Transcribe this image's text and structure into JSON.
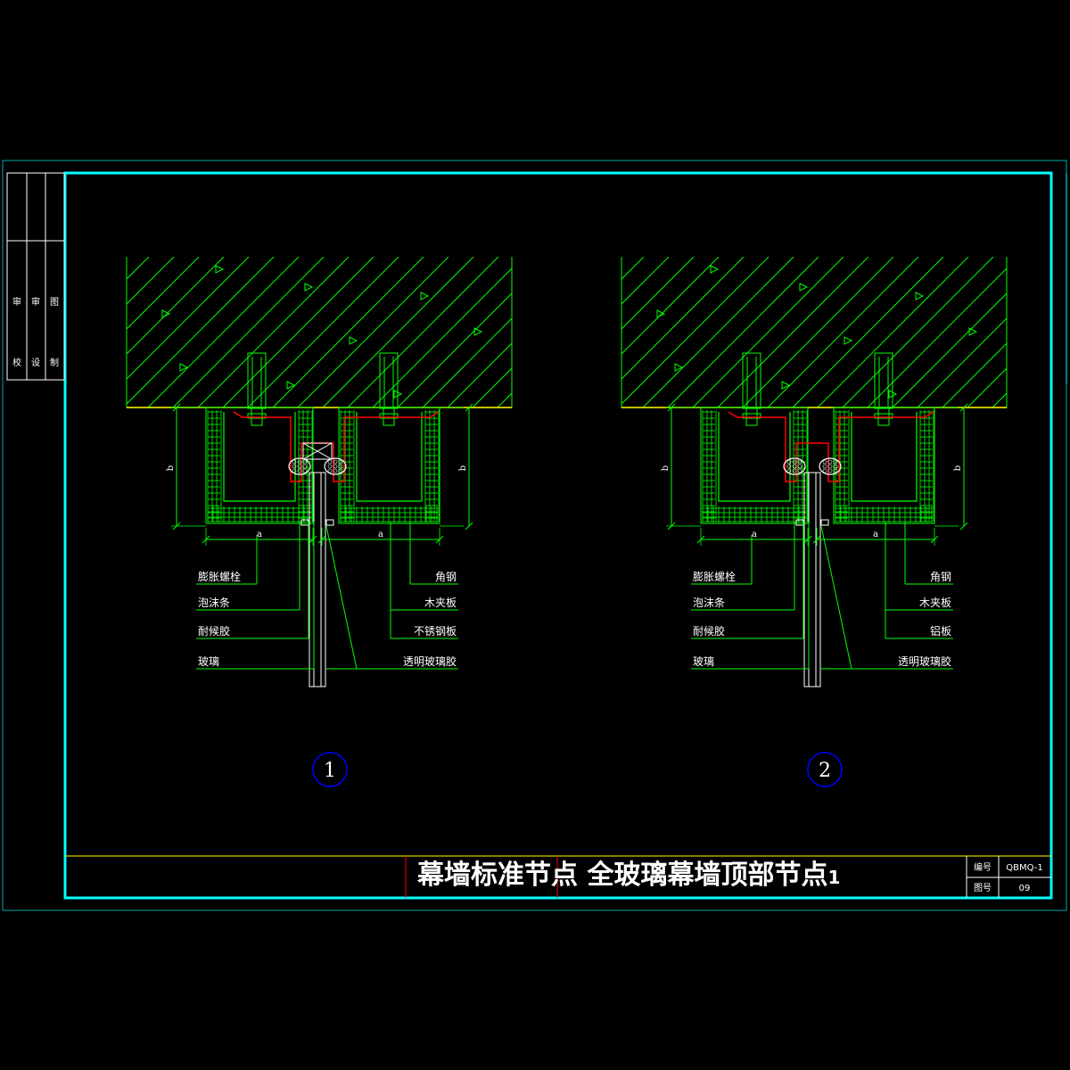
{
  "title": {
    "main": "幕墙标准节点 全玻璃幕墙顶部节点",
    "suffix": "1"
  },
  "title_block": {
    "code_label": "编号",
    "code_value": "QBMQ-1",
    "sheet_label": "图号",
    "sheet_value": "09"
  },
  "sign_column": {
    "top": [
      "审",
      "审",
      "图"
    ],
    "bottom": [
      "校",
      "设",
      "制"
    ]
  },
  "details": [
    {
      "number": "1",
      "dim_vertical": "b",
      "dim_horizontal": "a",
      "labels_left": [
        "膨胀螺栓",
        "泡沫条",
        "耐候胶",
        "玻璃"
      ],
      "labels_right": [
        "角钢",
        "木夹板",
        "不锈钢板",
        "透明玻璃胶"
      ]
    },
    {
      "number": "2",
      "dim_vertical": "b",
      "dim_horizontal": "a",
      "labels_left": [
        "膨胀螺栓",
        "泡沫条",
        "耐候胶",
        "玻璃"
      ],
      "labels_right": [
        "角钢",
        "木夹板",
        "铝板",
        "透明玻璃胶"
      ]
    }
  ],
  "colors": {
    "background": "#000000",
    "frame": "#00ffff",
    "geometry": "#00ff00",
    "steel_plate": "#ff0000",
    "concrete_edge": "#ffff00",
    "text": "#ffffff",
    "circle": "#0000ff"
  }
}
